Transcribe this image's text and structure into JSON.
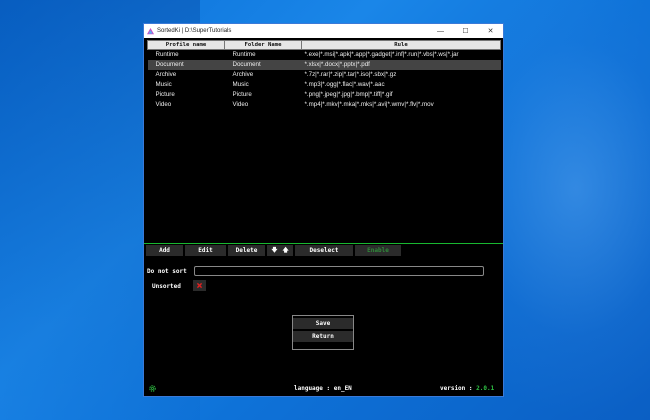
{
  "window": {
    "title": "SortedKi | D:\\SuperTutorials",
    "controls": {
      "minimize": "—",
      "maximize": "☐",
      "close": "✕"
    }
  },
  "table": {
    "headers": [
      "Profile name",
      "Folder Name",
      "Rule"
    ],
    "rows": [
      {
        "profile": "Runtime",
        "folder": "Runtime",
        "rule": "*.exe|*.msi|*.apk|*.app|*.gadget|*.inf|*.run|*.vbs|*.ws|*.jar"
      },
      {
        "profile": "Document",
        "folder": "Document",
        "rule": "*.xlsx|*.docx|*.pptx|*.pdf"
      },
      {
        "profile": "Archive",
        "folder": "Archive",
        "rule": "*.7z|*.rar|*.zip|*.tar|*.iso|*.sbx|*.gz"
      },
      {
        "profile": "Music",
        "folder": "Music",
        "rule": "*.mp3|*.ogg|*.flac|*.wav|*.aac"
      },
      {
        "profile": "Picture",
        "folder": "Picture",
        "rule": "*.png|*.jpeg|*.jpg|*.bmp|*.tiff|*.gif"
      },
      {
        "profile": "Video",
        "folder": "Video",
        "rule": "*.mp4|*.mkv|*.mka|*.mks|*.avi|*.wmv|*.flv|*.mov"
      }
    ],
    "selected_index": 1
  },
  "toolbar": {
    "add": "Add",
    "edit": "Edit",
    "delete": "Delete",
    "move_down": "🡇",
    "move_up": "🡅",
    "deselect": "Deselect",
    "enable": "Enable"
  },
  "options": {
    "do_not_sort_label": "Do not sort",
    "do_not_sort_value": "",
    "unsorted_label": "Unsorted"
  },
  "menu": {
    "save": "Save",
    "return": "Return"
  },
  "footer": {
    "language_label": "language : en_EN",
    "version_label": "version :",
    "version_number": "2.0.1"
  },
  "colors": {
    "accent_green": "#2ec043",
    "selected_row": "#444444",
    "unsorted_x": "#e02020"
  },
  "icons": {
    "app": "app-logo-icon",
    "settings": "gear-icon",
    "unsorted_state": "close-x-icon"
  }
}
